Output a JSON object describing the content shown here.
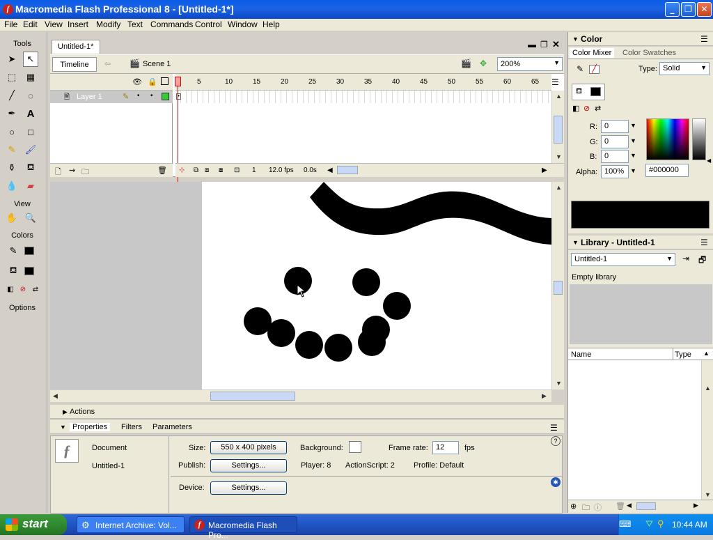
{
  "window": {
    "title": "Macromedia Flash Professional 8 - [Untitled-1*]",
    "logo": "flash-logo",
    "controls": {
      "minimize": "_",
      "maximize": "❐",
      "close": "✕"
    }
  },
  "menu": [
    "File",
    "Edit",
    "View",
    "Insert",
    "Modify",
    "Text",
    "Commands",
    "Control",
    "Window",
    "Help"
  ],
  "tools": {
    "header": "Tools",
    "view": "View",
    "colors": "Colors",
    "options": "Options"
  },
  "document": {
    "tab": "Untitled-1*",
    "timeline_button": "Timeline",
    "scene": "Scene 1",
    "zoom": "200%",
    "frame_numbers": [
      "1",
      "5",
      "10",
      "15",
      "20",
      "25",
      "30",
      "35",
      "40",
      "45",
      "50",
      "55",
      "60",
      "65"
    ],
    "layer_name": "Layer 1",
    "current_frame": "1",
    "fps": "12.0 fps",
    "elapsed": "0.0s"
  },
  "panels": {
    "actions": "Actions",
    "tabs": [
      "Properties",
      "Filters",
      "Parameters"
    ],
    "properties": {
      "doc_type": "Document",
      "doc_name": "Untitled-1",
      "size_label": "Size:",
      "size_value": "550 x 400 pixels",
      "background_label": "Background:",
      "frame_rate_label": "Frame rate:",
      "frame_rate_value": "12",
      "fps_unit": "fps",
      "publish_label": "Publish:",
      "settings_label": "Settings...",
      "player": "Player: 8",
      "actionscript": "ActionScript: 2",
      "profile": "Profile: Default",
      "device_label": "Device:"
    }
  },
  "color_panel": {
    "title": "Color",
    "tabs": [
      "Color Mixer",
      "Color Swatches"
    ],
    "type_label": "Type:",
    "type_value": "Solid",
    "r_label": "R:",
    "r": "0",
    "g_label": "G:",
    "g": "0",
    "b_label": "B:",
    "b": "0",
    "alpha_label": "Alpha:",
    "alpha": "100%",
    "hex": "#000000",
    "preview_color": "#000000"
  },
  "library_panel": {
    "title": "Library - Untitled-1",
    "select_value": "Untitled-1",
    "status": "Empty library",
    "col_name": "Name",
    "col_type": "Type"
  },
  "taskbar": {
    "start": "start",
    "tasks": [
      "Internet Archive: Vol...",
      "Macromedia Flash Pro..."
    ],
    "clock": "10:44 AM"
  }
}
